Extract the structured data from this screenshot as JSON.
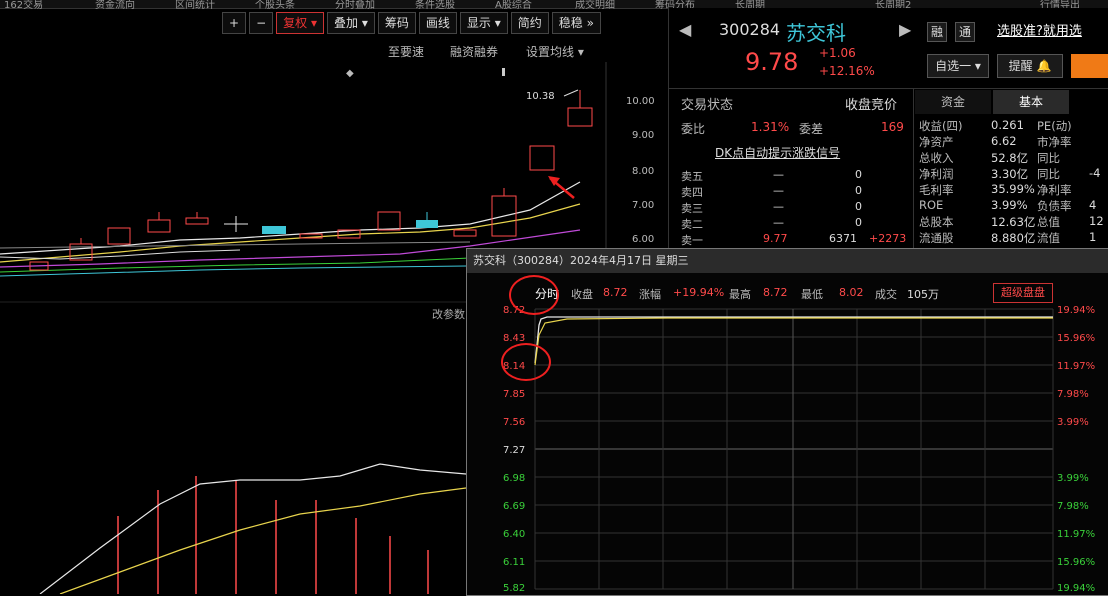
{
  "topbar": {
    "items": [
      "162交易",
      "资金流向",
      "区间统计",
      "个股头条",
      "分时叠加",
      "条件选股",
      "A股综合",
      "成交明细",
      "筹码分布",
      "长周期",
      "长周期2",
      "行情导出"
    ]
  },
  "toolbar": {
    "plus": "+",
    "minus": "−",
    "fq": "复权",
    "overlay": "叠加",
    "chips": "筹码",
    "draw": "画线",
    "display": "显示",
    "simple": "简约",
    "more": "稳稳",
    "more_arrow": "»"
  },
  "subtoolbar": {
    "a": "至要速",
    "b": "融资融券",
    "c": "设置均线"
  },
  "main_chart": {
    "high_label": "10.38",
    "price_axis": [
      "10.00",
      "9.00",
      "8.00",
      "7.00",
      "6.00"
    ],
    "bottom_label": "改参数"
  },
  "stock": {
    "code": "300284",
    "name": "苏交科",
    "price": "9.78",
    "change": "+1.06",
    "change_pct": "+12.16%",
    "watch_btn": "自选一",
    "alert_btn": "提醒",
    "tag1": "融",
    "tag2": "通",
    "promo": "选股准?就用选"
  },
  "trade_panel": {
    "status_label": "交易状态",
    "status_value": "收盘竞价",
    "wei_label": "委比",
    "wei_value": "1.31%",
    "wei_diff_label": "委差",
    "wei_diff_value": "169",
    "signal": "DK点自动提示涨跌信号",
    "asks": [
      {
        "label": "卖五",
        "price": "—",
        "vol": "0"
      },
      {
        "label": "卖四",
        "price": "—",
        "vol": "0"
      },
      {
        "label": "卖三",
        "price": "—",
        "vol": "0"
      },
      {
        "label": "卖二",
        "price": "—",
        "vol": "0"
      },
      {
        "label": "卖一",
        "price": "9.77",
        "vol": "6371",
        "chg": "+2273"
      }
    ]
  },
  "fund_panel": {
    "tabs": [
      "资金",
      "基本"
    ],
    "rows": [
      {
        "label": "收益(四)",
        "value": "0.261",
        "label2": "PE(动)",
        "value2": ""
      },
      {
        "label": "净资产",
        "value": "6.62",
        "label2": "市净率",
        "value2": ""
      },
      {
        "label": "总收入",
        "value": "52.8亿",
        "label2": "同比",
        "value2": ""
      },
      {
        "label": "净利润",
        "value": "3.30亿",
        "label2": "同比",
        "value2": "-4"
      },
      {
        "label": "毛利率",
        "value": "35.99%",
        "label2": "净利率",
        "value2": ""
      },
      {
        "label": "ROE",
        "value": "3.99%",
        "label2": "负债率",
        "value2": "4"
      },
      {
        "label": "总股本",
        "value": "12.63亿",
        "label2": "总值",
        "value2": "12"
      },
      {
        "label": "流通股",
        "value": "8.880亿",
        "label2": "流值",
        "value2": "1"
      }
    ]
  },
  "popup": {
    "title": "苏交科（300284）2024年4月17日 星期三",
    "fenshi": "分时",
    "close_label": "收盘",
    "close_value": "8.72",
    "chg_label": "涨幅",
    "chg_value": "+19.94%",
    "high_label": "最高",
    "high_value": "8.72",
    "low_label": "最低",
    "low_value": "8.02",
    "vol_label": "成交",
    "vol_value": "105万",
    "btn": "超级盘盘",
    "left_axis": [
      "8.72",
      "8.43",
      "8.14",
      "7.85",
      "7.56",
      "7.27",
      "6.98",
      "6.69",
      "6.40",
      "6.11",
      "5.82"
    ],
    "right_axis": [
      "19.94%",
      "15.96%",
      "11.97%",
      "7.98%",
      "3.99%",
      "",
      "3.99%",
      "7.98%",
      "11.97%",
      "15.96%",
      "19.94%"
    ]
  },
  "colors": {
    "up": "#ff4a4a",
    "down": "#3ad13a",
    "accent": "#e8d44d",
    "cyan": "#3ec6d8"
  }
}
